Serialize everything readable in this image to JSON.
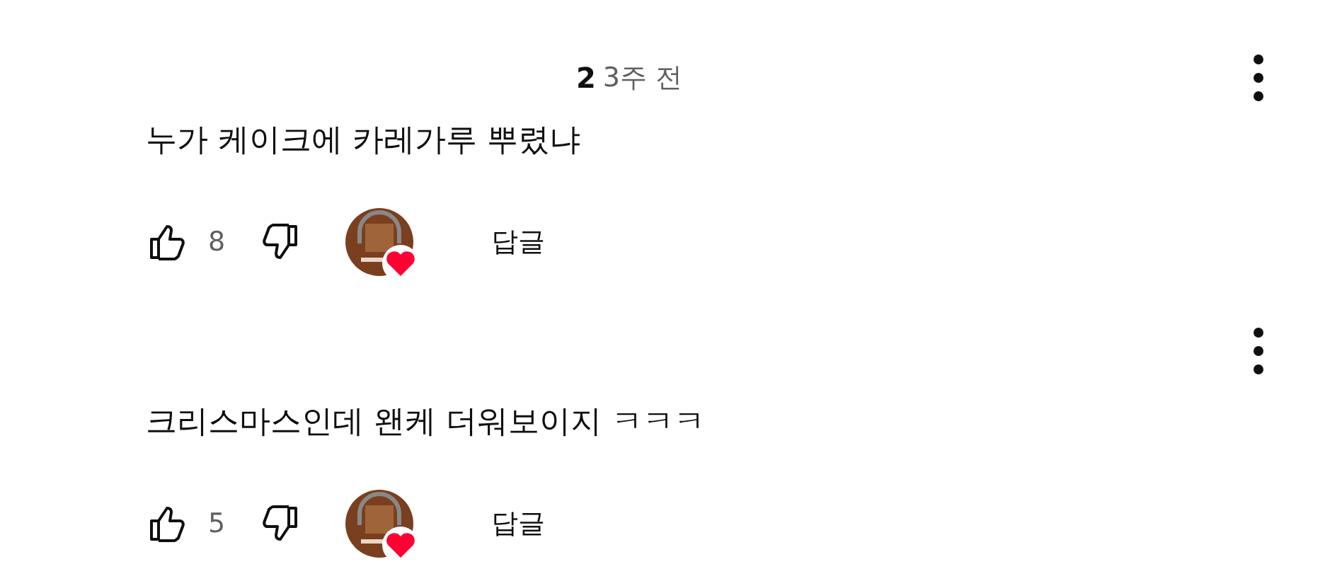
{
  "comments": [
    {
      "author_fragment": "2",
      "time": "3주 전",
      "text": "누가 케이크에 카레가루 뿌렸냐",
      "likes": "8",
      "hearted": true,
      "reply": "답글"
    },
    {
      "text": "크리스마스인데 왠케 더워보이지 ㅋㅋㅋ",
      "likes": "5",
      "hearted": true,
      "reply": "답글"
    }
  ]
}
